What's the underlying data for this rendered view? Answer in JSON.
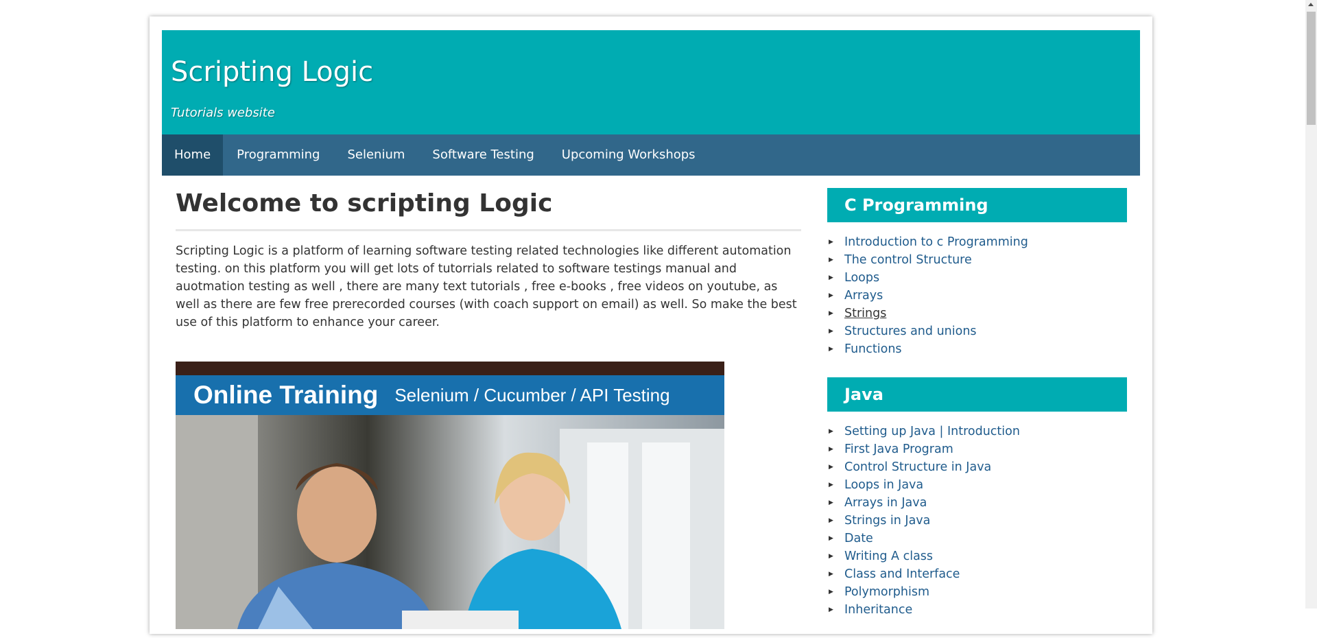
{
  "header": {
    "title": "Scripting Logic",
    "tagline": "Tutorials website"
  },
  "nav": {
    "items": [
      {
        "label": "Home",
        "active": true
      },
      {
        "label": "Programming"
      },
      {
        "label": "Selenium"
      },
      {
        "label": "Software Testing"
      },
      {
        "label": "Upcoming Workshops"
      }
    ]
  },
  "main": {
    "title": "Welcome to scripting Logic",
    "intro": "Scripting Logic is a platform of learning software testing related technologies like different automation testing. on this platform you will get lots of tutorrials related to software testings manual and auotmation testing as well , there are many text tutorials , free e-books , free videos on youtube, as well as there are few free prerecorded courses (with coach support on email) as well. So make the best use of this platform to enhance your career.",
    "banner": {
      "heading": "Online Training",
      "subheading": "Selenium / Cucumber / API Testing"
    }
  },
  "sidebar": {
    "c_programming": {
      "title": "C Programming",
      "links": [
        "Introduction to c Programming",
        "The control Structure",
        "Loops",
        "Arrays",
        "Strings",
        "Structures and unions",
        "Functions"
      ]
    },
    "java": {
      "title": "Java",
      "links": [
        "Setting up Java | Introduction",
        "First Java Program",
        "Control Structure in Java",
        "Loops in Java",
        "Arrays in Java",
        "Strings in Java",
        "Date",
        "Writing A class",
        "Class and Interface",
        "Polymorphism",
        "Inheritance"
      ]
    }
  },
  "colors": {
    "header_bg": "#00acb2",
    "nav_bg": "#31678a",
    "nav_active_bg": "#1f4e6a",
    "link": "#1f5b8c"
  }
}
